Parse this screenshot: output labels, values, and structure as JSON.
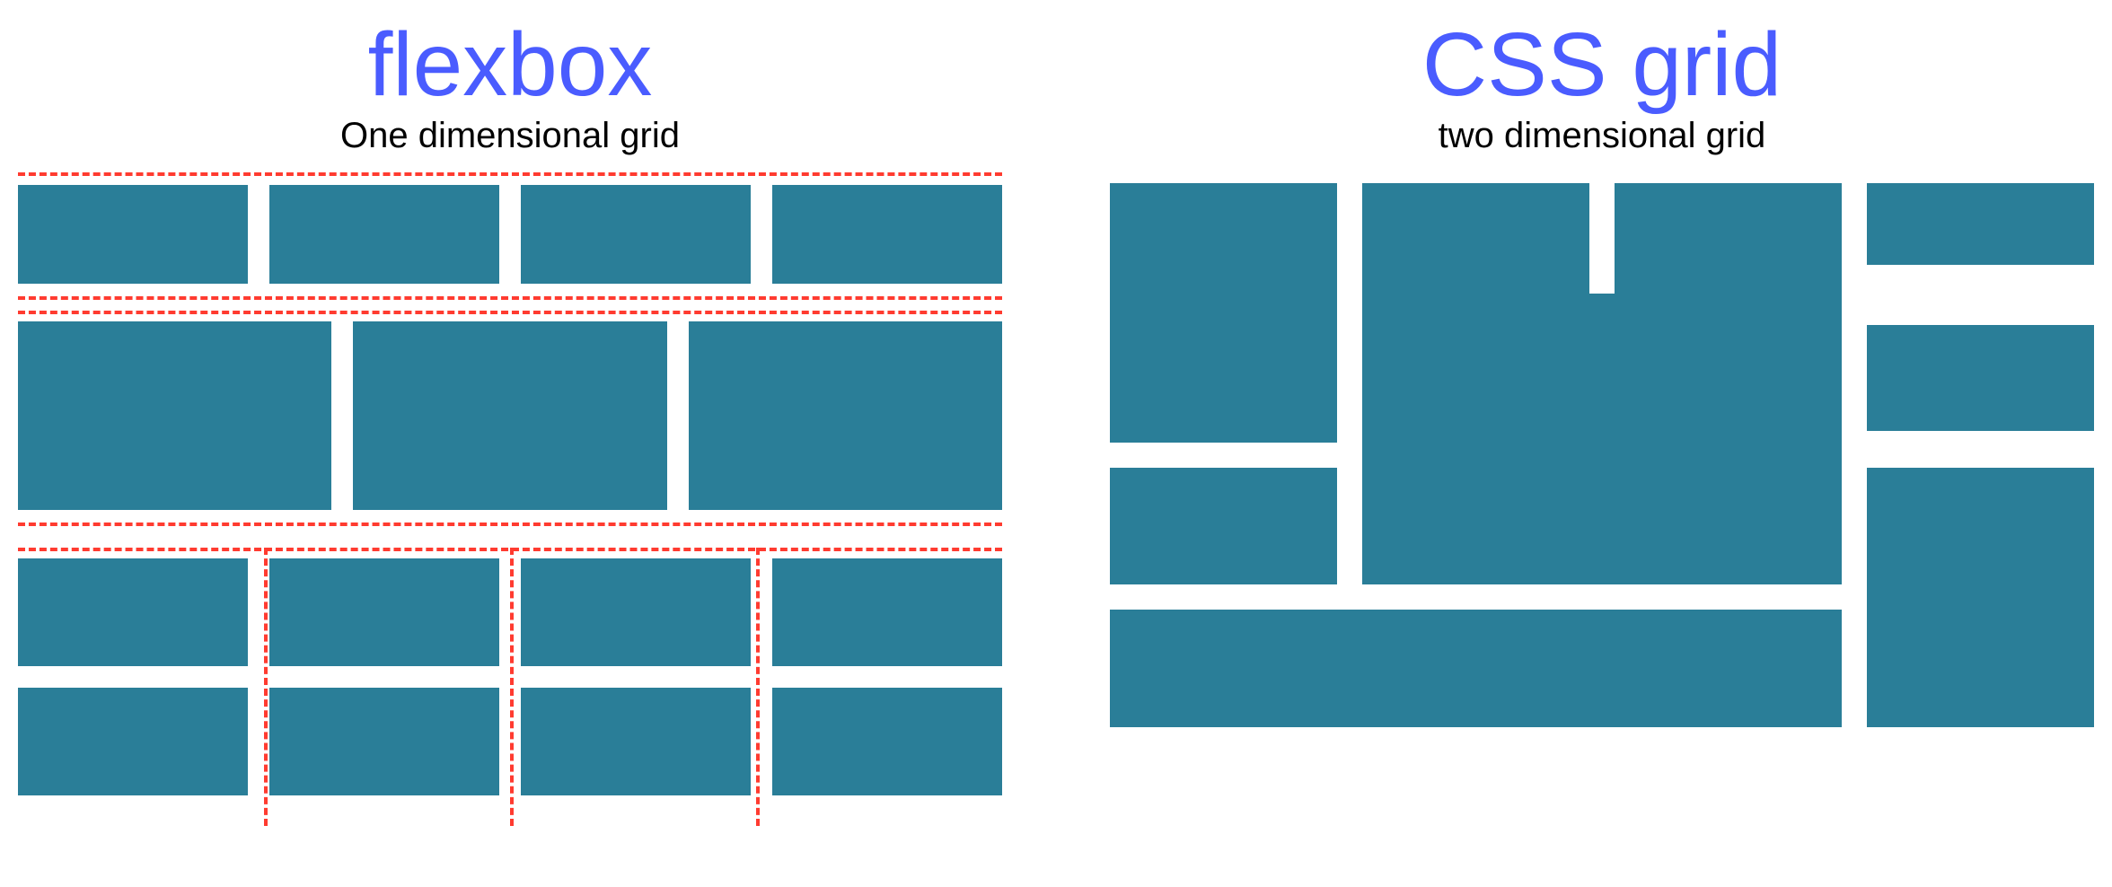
{
  "colors": {
    "box": "#2a7e98",
    "title": "#4a5cff",
    "dash": "#ff3b30"
  },
  "flex": {
    "title": "flexbox",
    "subtitle": "One dimensional grid",
    "rows": [
      {
        "boxes": 4
      },
      {
        "boxes": 3
      },
      {
        "boxes": 4
      },
      {
        "boxes": 4
      }
    ]
  },
  "grid": {
    "title": "CSS grid",
    "subtitle": "two dimensional grid",
    "items": 9
  }
}
